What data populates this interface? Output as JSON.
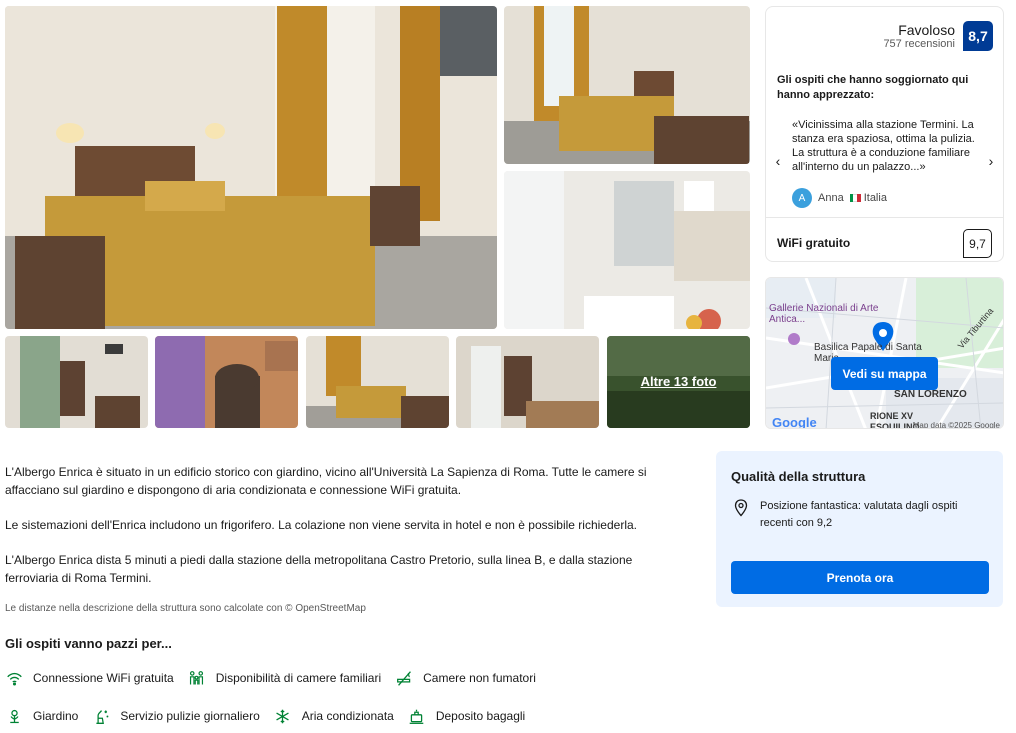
{
  "gallery": {
    "more_photos_label": "Altre 13 foto"
  },
  "review_card": {
    "rating_word": "Favoloso",
    "review_count": "757 recensioni",
    "score": "8,7",
    "liked_title": "Gli ospiti che hanno soggiornato qui hanno apprezzato:",
    "quote": "«Vicinissima alla stazione Termini. La stanza era spaziosa, ottima la pulizia. La struttura è a conduzione familiare all'interno du un palazzo...»",
    "prev_arrow": "‹",
    "next_arrow": "›",
    "reviewer_initial": "A",
    "reviewer_name": "Anna",
    "reviewer_country": "Italia",
    "wifi_label": "WiFi gratuito",
    "wifi_score": "9,7"
  },
  "map": {
    "label_gallerie": "Gallerie Nazionali di Arte Antica...",
    "label_basilica": "Basilica Papale di Santa Maria...",
    "label_via": "Via Tiburtina",
    "label_lorenzo": "SAN LORENZO",
    "label_rione": "RIONE XV ESQUILINO",
    "google": "Google",
    "copyright": "Map data ©2025 Google",
    "button_label": "Vedi su mappa"
  },
  "description": {
    "paragraphs": [
      "L'Albergo Enrica è situato in un edificio storico con giardino, vicino all'Università La Sapienza di Roma. Tutte le camere si affacciano sul giardino e dispongono di aria condizionata e connessione WiFi gratuita.",
      "Le sistemazioni dell'Enrica includono un frigorifero. La colazione non viene servita in hotel e non è possibile richiederla.",
      "L'Albergo Enrica dista 5 minuti a piedi dalla stazione della metropolitana Castro Pretorio, sulla linea B, e dalla stazione ferroviaria di Roma Termini."
    ],
    "osm_note": "Le distanze nella descrizione della struttura sono calcolate con © OpenStreetMap"
  },
  "favourites": {
    "title": "Gli ospiti vanno pazzi per...",
    "row1": [
      {
        "label": "Connessione WiFi gratuita",
        "icon": "wifi-icon"
      },
      {
        "label": "Disponibilità di camere familiari",
        "icon": "family-icon"
      },
      {
        "label": "Camere non fumatori",
        "icon": "no-smoking-icon"
      }
    ],
    "row2": [
      {
        "label": "Giardino",
        "icon": "garden-icon"
      },
      {
        "label": "Servizio pulizie giornaliero",
        "icon": "cleaning-icon"
      },
      {
        "label": "Aria condizionata",
        "icon": "snowflake-icon"
      },
      {
        "label": "Deposito bagagli",
        "icon": "luggage-icon"
      }
    ]
  },
  "quality": {
    "title": "Qualità della struttura",
    "location_text": "Posizione fantastica: valutata dagli ospiti recenti con 9,2",
    "book_label": "Prenota ora"
  },
  "colors": {
    "brand_blue": "#003b95",
    "action_blue": "#006ce4",
    "facility_green": "#008234",
    "quality_bg": "#ebf3ff"
  }
}
